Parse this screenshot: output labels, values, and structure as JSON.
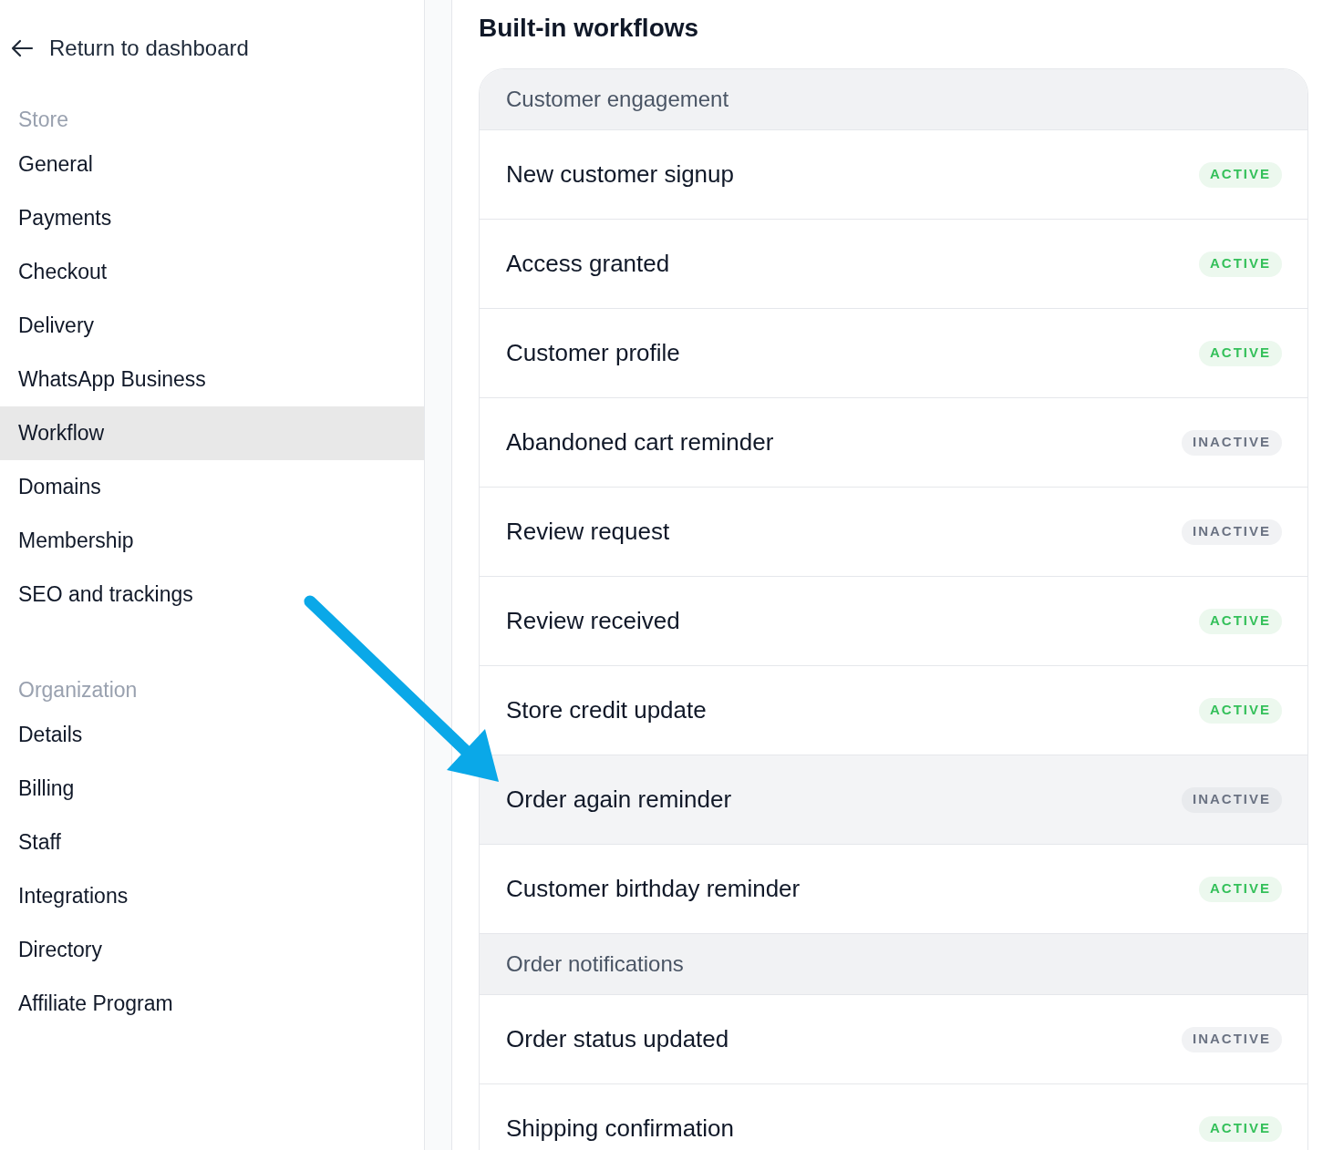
{
  "sidebar": {
    "back_link": "Return to dashboard",
    "sections": [
      {
        "title": "Store",
        "items": [
          {
            "label": "General",
            "selected": false
          },
          {
            "label": "Payments",
            "selected": false
          },
          {
            "label": "Checkout",
            "selected": false
          },
          {
            "label": "Delivery",
            "selected": false
          },
          {
            "label": "WhatsApp Business",
            "selected": false
          },
          {
            "label": "Workflow",
            "selected": true
          },
          {
            "label": "Domains",
            "selected": false
          },
          {
            "label": "Membership",
            "selected": false
          },
          {
            "label": "SEO and trackings",
            "selected": false
          }
        ]
      },
      {
        "title": "Organization",
        "items": [
          {
            "label": "Details",
            "selected": false
          },
          {
            "label": "Billing",
            "selected": false
          },
          {
            "label": "Staff",
            "selected": false
          },
          {
            "label": "Integrations",
            "selected": false
          },
          {
            "label": "Directory",
            "selected": false
          },
          {
            "label": "Affiliate Program",
            "selected": false
          }
        ]
      }
    ]
  },
  "main": {
    "title": "Built-in workflows",
    "groups": [
      {
        "title": "Customer engagement",
        "rows": [
          {
            "name": "New customer signup",
            "status": "ACTIVE",
            "active": true,
            "hovered": false
          },
          {
            "name": "Access granted",
            "status": "ACTIVE",
            "active": true,
            "hovered": false
          },
          {
            "name": "Customer profile",
            "status": "ACTIVE",
            "active": true,
            "hovered": false
          },
          {
            "name": "Abandoned cart reminder",
            "status": "INACTIVE",
            "active": false,
            "hovered": false
          },
          {
            "name": "Review request",
            "status": "INACTIVE",
            "active": false,
            "hovered": false
          },
          {
            "name": "Review received",
            "status": "ACTIVE",
            "active": true,
            "hovered": false
          },
          {
            "name": "Store credit update",
            "status": "ACTIVE",
            "active": true,
            "hovered": false
          },
          {
            "name": "Order again reminder",
            "status": "INACTIVE",
            "active": false,
            "hovered": true
          },
          {
            "name": "Customer birthday reminder",
            "status": "ACTIVE",
            "active": true,
            "hovered": false
          }
        ]
      },
      {
        "title": "Order notifications",
        "rows": [
          {
            "name": "Order status updated",
            "status": "INACTIVE",
            "active": false,
            "hovered": false
          },
          {
            "name": "Shipping confirmation",
            "status": "ACTIVE",
            "active": true,
            "hovered": false
          }
        ]
      }
    ]
  }
}
